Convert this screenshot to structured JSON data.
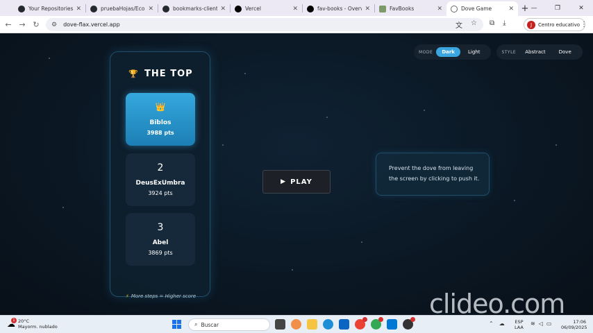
{
  "browser": {
    "tabs": [
      {
        "title": "Your Repositories",
        "icon": "github-icon"
      },
      {
        "title": "pruebaHojas/Eco at",
        "icon": "github-icon"
      },
      {
        "title": "bookmarks-cliente/",
        "icon": "github-icon"
      },
      {
        "title": "Vercel",
        "icon": "vercel-icon"
      },
      {
        "title": "fav-books - Overvie",
        "icon": "vercel-icon"
      },
      {
        "title": "FavBooks",
        "icon": "favbooks-icon"
      },
      {
        "title": "Dove Game",
        "icon": "globe-icon",
        "active": true
      }
    ],
    "url": "dove-flax.vercel.app",
    "profile_label": "Centro educativo",
    "profile_initial": "J"
  },
  "game": {
    "leaderboard": {
      "trophy": "🏆",
      "title": "THE TOP",
      "entries": [
        {
          "rank": "👑",
          "name": "Biblos",
          "score": "3988 pts"
        },
        {
          "rank": "2",
          "name": "DeusExUmbra",
          "score": "3924 pts"
        },
        {
          "rank": "3",
          "name": "Abel",
          "score": "3869 pts"
        }
      ],
      "hint_icon": "⚡",
      "hint": "More steps = Higher score"
    },
    "play_label": "PLAY",
    "info": "Prevent the dove from leaving the screen by clicking to push it.",
    "controls": {
      "mode_label": "MODE",
      "mode_options": [
        "Dark",
        "Light"
      ],
      "mode_selected": "Dark",
      "style_label": "STYLE",
      "style_options": [
        "Abstract",
        "Dove"
      ]
    }
  },
  "watermark": "clideo.com",
  "taskbar": {
    "weather_badge": "1",
    "temperature": "20°C",
    "weather_desc": "Mayorm. nublado",
    "search_placeholder": "Buscar",
    "lang_top": "ESP",
    "lang_bottom": "LAA",
    "time": "17:06",
    "date": "06/09/2025"
  },
  "colors": {
    "accent": "#3aa5df",
    "page_bg": "#0b1622",
    "panel_border": "#1f4f6b"
  }
}
